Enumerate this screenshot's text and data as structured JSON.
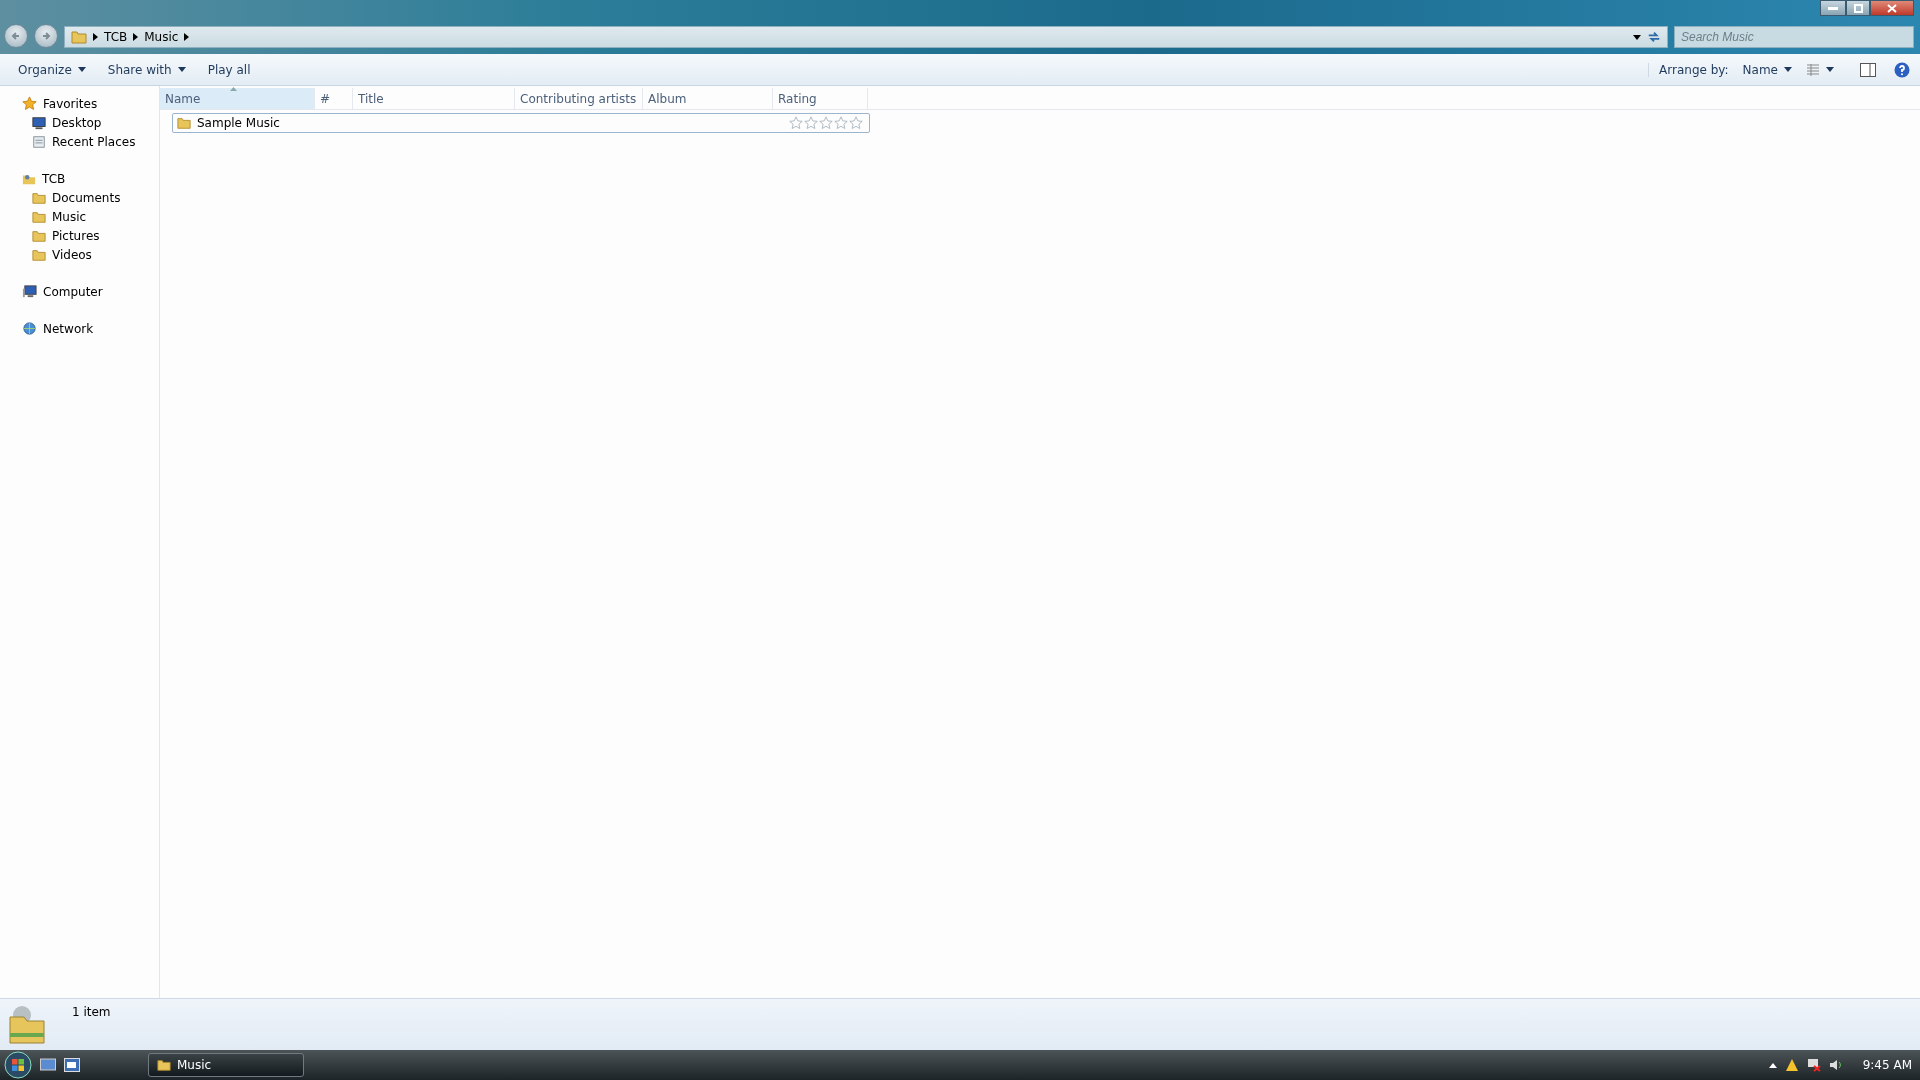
{
  "address": {
    "crumbs": [
      "TCB",
      "Music"
    ]
  },
  "search": {
    "placeholder": "Search Music"
  },
  "toolbar": {
    "buttons": [
      {
        "label": "Organize",
        "dropdown": true
      },
      {
        "label": "Share with",
        "dropdown": true
      },
      {
        "label": "Play all",
        "dropdown": false
      }
    ],
    "arrange_label": "Arrange by:",
    "arrange_value": "Name"
  },
  "sidebar": {
    "groups": [
      {
        "label": "Favorites",
        "children": [
          {
            "label": "Desktop"
          },
          {
            "label": "Recent Places"
          }
        ]
      },
      {
        "label": "TCB",
        "children": [
          {
            "label": "Documents"
          },
          {
            "label": "Music"
          },
          {
            "label": "Pictures"
          },
          {
            "label": "Videos"
          }
        ]
      },
      {
        "label": "Computer"
      },
      {
        "label": "Network"
      }
    ]
  },
  "table": {
    "columns": [
      {
        "label": "Name",
        "selected": true
      },
      {
        "label": "#",
        "selected": false
      },
      {
        "label": "Title",
        "selected": false
      },
      {
        "label": "Contributing artists",
        "selected": false
      },
      {
        "label": "Album",
        "selected": false
      },
      {
        "label": "Rating",
        "selected": false
      }
    ],
    "rows": [
      {
        "name": "Sample Music",
        "stars": 0
      }
    ]
  },
  "status_bar": {
    "text": "1 item"
  },
  "taskbar": {
    "task": "Music",
    "clock": "9:45 AM"
  }
}
